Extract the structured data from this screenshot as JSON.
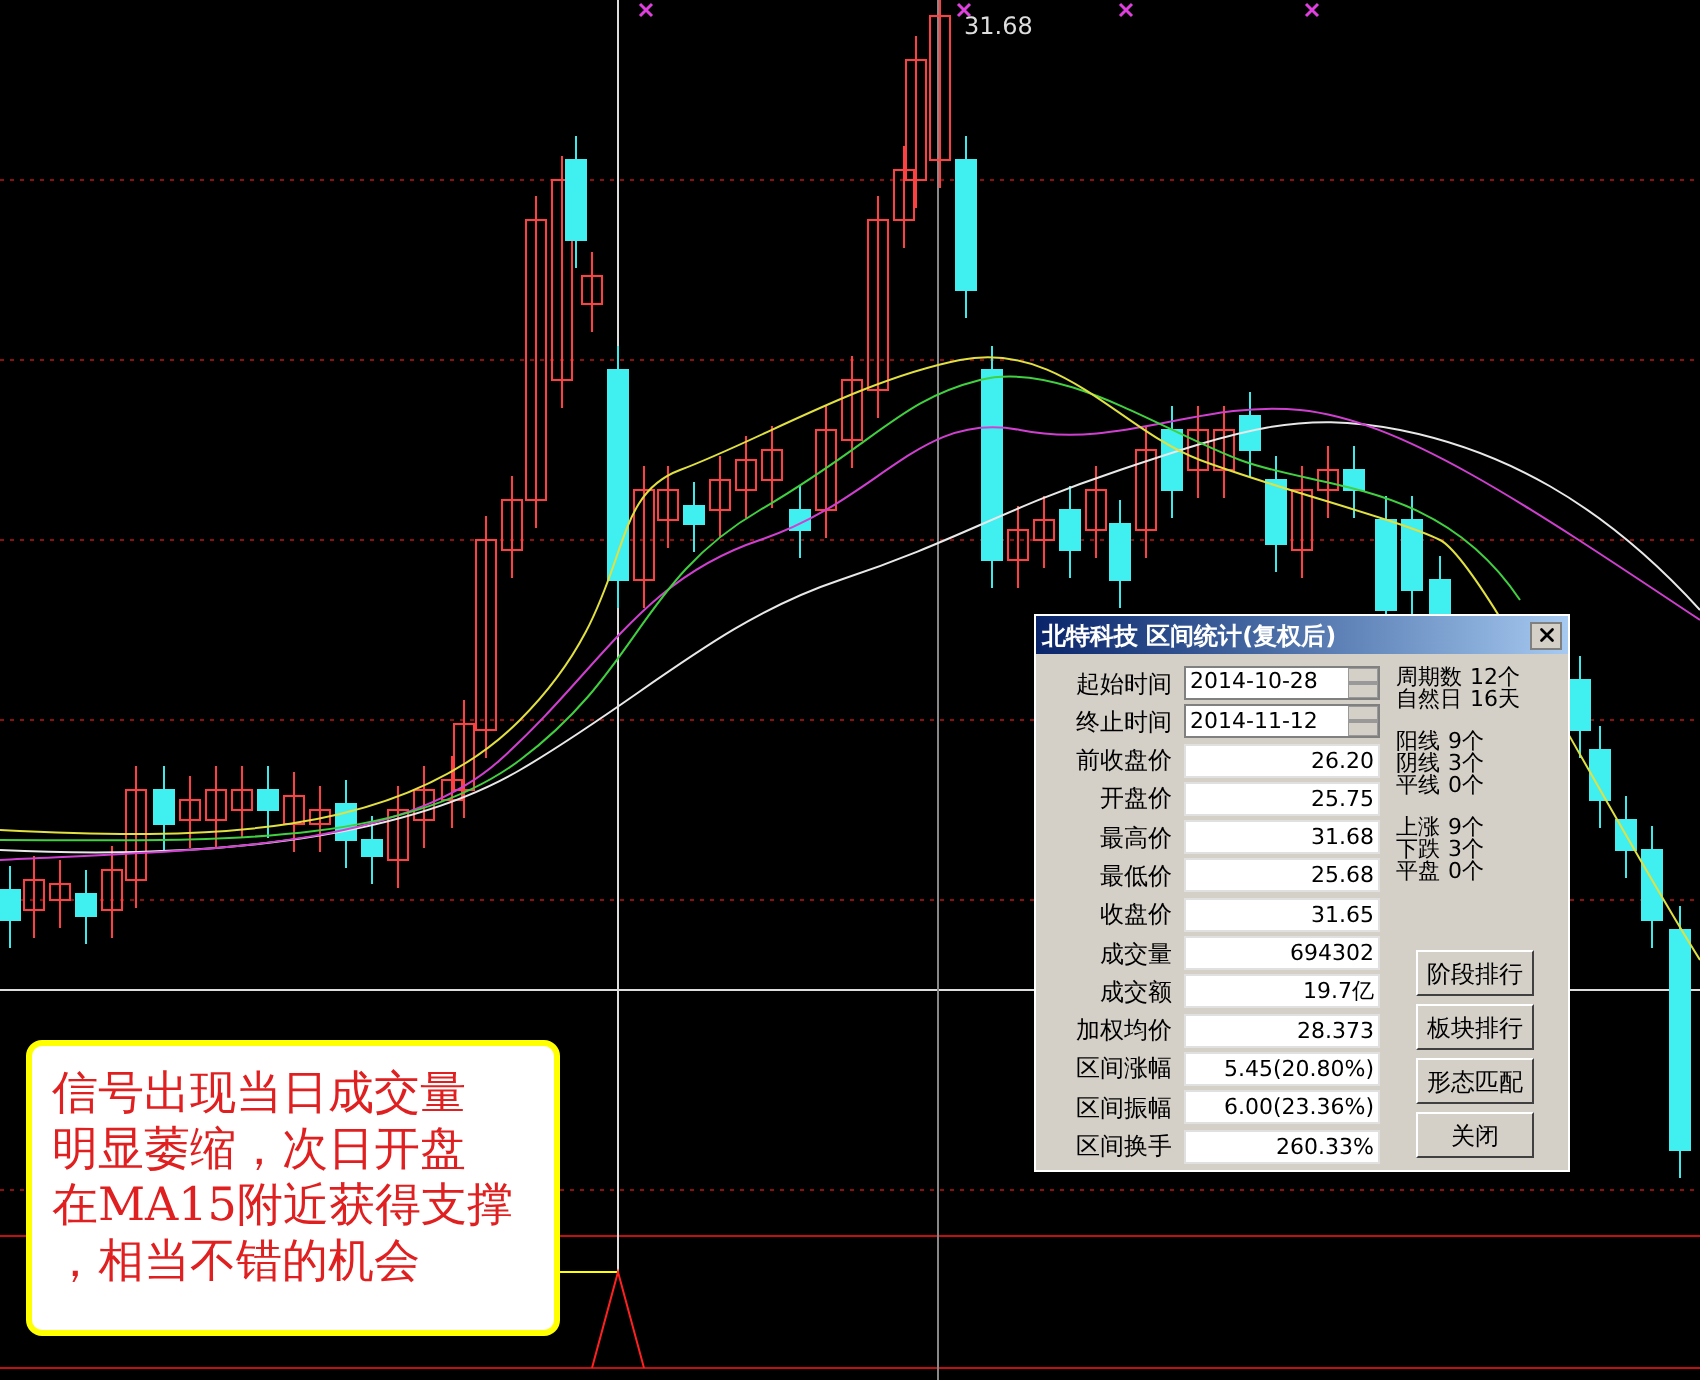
{
  "chart": {
    "high_label": "31.68"
  },
  "dialog": {
    "title": "北特科技 区间统计(复权后)",
    "date_fields": [
      {
        "label": "起始时间",
        "value": "2014-10-28"
      },
      {
        "label": "终止时间",
        "value": "2014-11-12"
      }
    ],
    "fields": [
      {
        "label": "前收盘价",
        "value": "26.20"
      },
      {
        "label": "开盘价",
        "value": "25.75"
      },
      {
        "label": "最高价",
        "value": "31.68"
      },
      {
        "label": "最低价",
        "value": "25.68"
      },
      {
        "label": "收盘价",
        "value": "31.65"
      },
      {
        "label": "成交量",
        "value": "694302"
      },
      {
        "label": "成交额",
        "value": "19.7亿"
      },
      {
        "label": "加权均价",
        "value": "28.373"
      },
      {
        "label": "区间涨幅",
        "value": "5.45(20.80%)"
      },
      {
        "label": "区间振幅",
        "value": "6.00(23.36%)"
      },
      {
        "label": "区间换手",
        "value": "260.33%"
      }
    ],
    "stat_groups": [
      {
        "items": [
          {
            "label": "周期数",
            "value": "12个"
          },
          {
            "label": "自然日",
            "value": "16天"
          }
        ]
      },
      {
        "items": [
          {
            "label": "阳线",
            "value": "9个"
          },
          {
            "label": "阴线",
            "value": "3个"
          },
          {
            "label": "平线",
            "value": "0个"
          }
        ]
      },
      {
        "items": [
          {
            "label": "上涨",
            "value": "9个"
          },
          {
            "label": "下跌",
            "value": "3个"
          },
          {
            "label": "平盘",
            "value": "0个"
          }
        ]
      }
    ],
    "buttons": [
      "阶段排行",
      "板块排行",
      "形态匹配",
      "关闭"
    ]
  },
  "annotation": {
    "lines": [
      "信号出现当日成交量",
      "明显萎缩，次日开盘",
      "在MA15附近获得支撑",
      "，相当不错的机会"
    ]
  }
}
